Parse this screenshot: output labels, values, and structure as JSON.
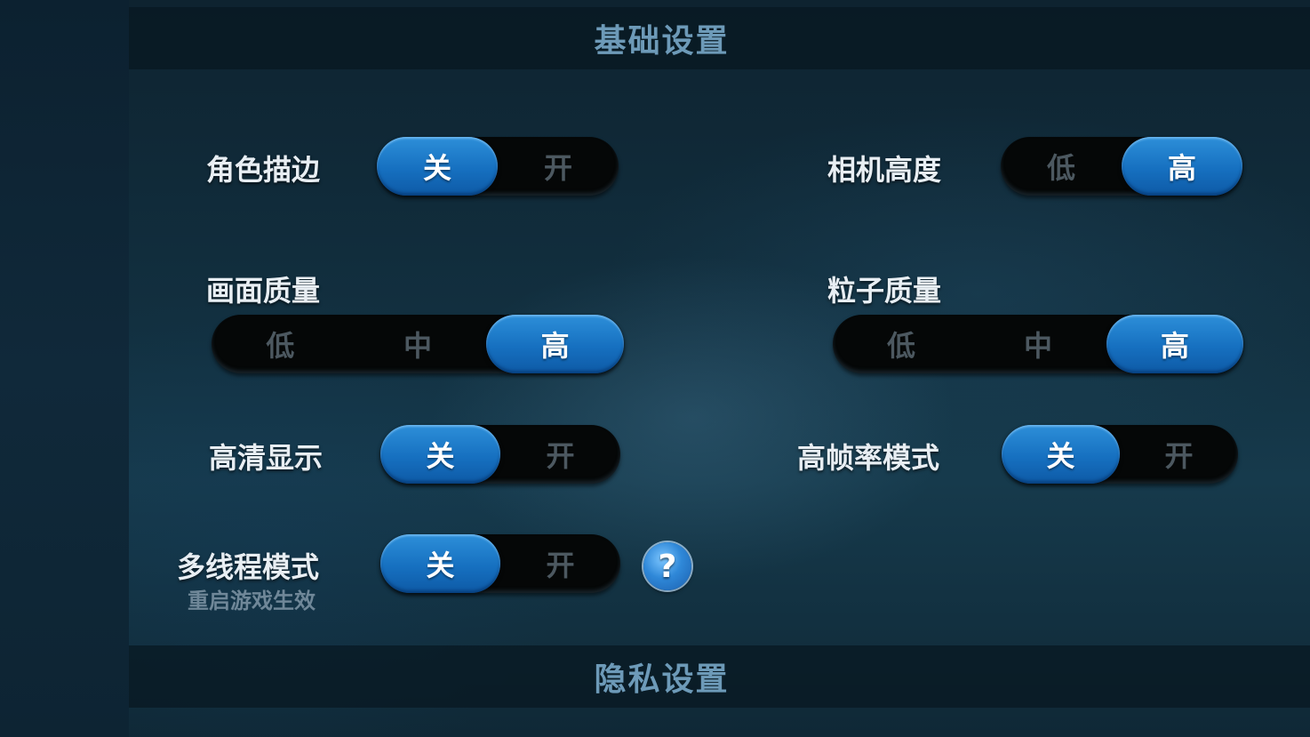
{
  "sections": {
    "basic_title": "基础设置",
    "privacy_title": "隐私设置"
  },
  "settings": {
    "outline": {
      "label": "角色描边",
      "options": [
        "关",
        "开"
      ],
      "selected": "关"
    },
    "camera_height": {
      "label": "相机高度",
      "options": [
        "低",
        "高"
      ],
      "selected": "高"
    },
    "graphics_quality": {
      "label": "画面质量",
      "options": [
        "低",
        "中",
        "高"
      ],
      "selected": "高"
    },
    "particle_quality": {
      "label": "粒子质量",
      "options": [
        "低",
        "中",
        "高"
      ],
      "selected": "高"
    },
    "hd_display": {
      "label": "高清显示",
      "options": [
        "关",
        "开"
      ],
      "selected": "关"
    },
    "high_framerate": {
      "label": "高帧率模式",
      "options": [
        "关",
        "开"
      ],
      "selected": "关"
    },
    "multithread": {
      "label": "多线程模式",
      "sublabel": "重启游戏生效",
      "options": [
        "关",
        "开"
      ],
      "selected": "关"
    }
  },
  "help_icon": {
    "glyph": "?",
    "icon": "question-circle-icon"
  },
  "colors": {
    "active_blue": "#1670c0",
    "title_blue": "#6d9ab8"
  }
}
